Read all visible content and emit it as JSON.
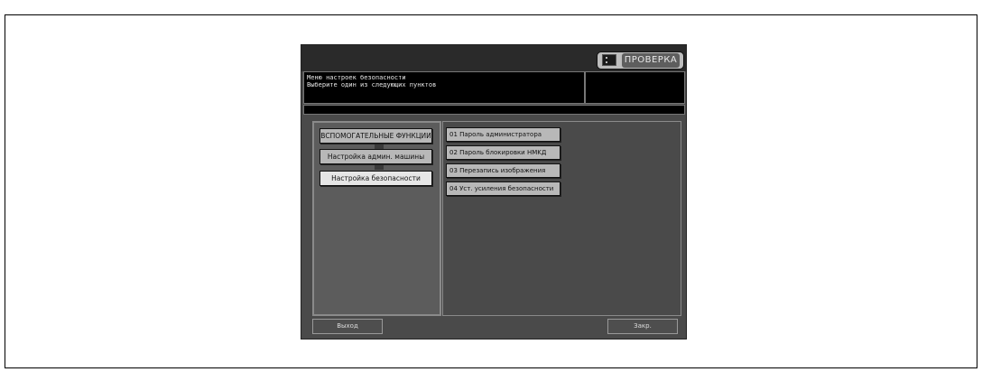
{
  "header": {
    "check_button_label": "ПРОВЕРКА"
  },
  "message": {
    "line1": "Меню настроек безопасности",
    "line2": "Выберите один из следующих пунктов"
  },
  "nav": {
    "items": [
      {
        "label": "ВСПОМОГАТЕЛЬНЫЕ ФУНКЦИИ",
        "active": false
      },
      {
        "label": "Настройка админ. машины",
        "active": false
      },
      {
        "label": "Настройка безопасности",
        "active": true
      }
    ]
  },
  "menu": {
    "items": [
      {
        "label": "01 Пароль администратора"
      },
      {
        "label": "02 Пароль блокировки HMKД"
      },
      {
        "label": "03 Перезапись изображения"
      },
      {
        "label": "04 Уст. усиления безопасности"
      }
    ]
  },
  "footer": {
    "exit_label": "Выход",
    "close_label": "Закр."
  }
}
